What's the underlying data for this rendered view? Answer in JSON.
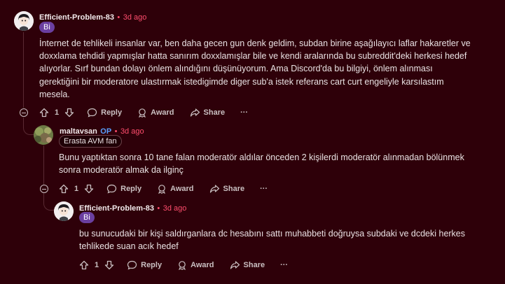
{
  "comments": [
    {
      "author": "Efficient-Problem-83",
      "separator": "•",
      "time": "3d ago",
      "flair": "Bi",
      "body": "İnternet de tehlikeli insanlar var, ben daha gecen gun denk geldim, subdan birine aşağılayıcı laflar hakaretler ve doxxlama tehdidi yapmışlar hatta sanırım doxxlamışlar bile ve kendi aralarında bu subreddit'deki herkesi hedef alıyorlar. Sırf bundan dolayı önlem alındığını düşünüyorum. Ama Discord'da bu bilgiyi, önlem alınması gerektiğini bir moderatore ulastırmak istedigimde diger sub'a istek referans cart curt engeliyle karsılastım mesela.",
      "score": "1",
      "reply": "Reply",
      "award": "Award",
      "share": "Share",
      "more": "···"
    },
    {
      "author": "maltavsan",
      "op": "OP",
      "separator": "•",
      "time": "3d ago",
      "flair": "Erasta AVM fan",
      "body": "Bunu yaptıktan sonra 10 tane falan moderatör aldılar önceden 2 kişilerdi moderatör alınmadan bölünmek sonra moderatör almak da ilginç",
      "score": "1",
      "reply": "Reply",
      "award": "Award",
      "share": "Share",
      "more": "···"
    },
    {
      "author": "Efficient-Problem-83",
      "separator": "•",
      "time": "3d ago",
      "flair": "Bi",
      "body": "bu sunucudaki bir kişi saldırganlara dc hesabını sattı muhabbeti doğruysa subdaki ve dcdeki herkes tehlikede suan acık hedef",
      "score": "1",
      "reply": "Reply",
      "award": "Award",
      "share": "Share",
      "more": "···"
    }
  ],
  "colors": {
    "background": "#2e0009",
    "time_accent": "#ff4d6d",
    "op_accent": "#5aa0ff",
    "flair_purple": "#6b3fa0"
  },
  "icons": [
    "upvote-icon",
    "downvote-icon",
    "reply-icon",
    "award-icon",
    "share-icon",
    "more-icon",
    "collapse-icon"
  ]
}
